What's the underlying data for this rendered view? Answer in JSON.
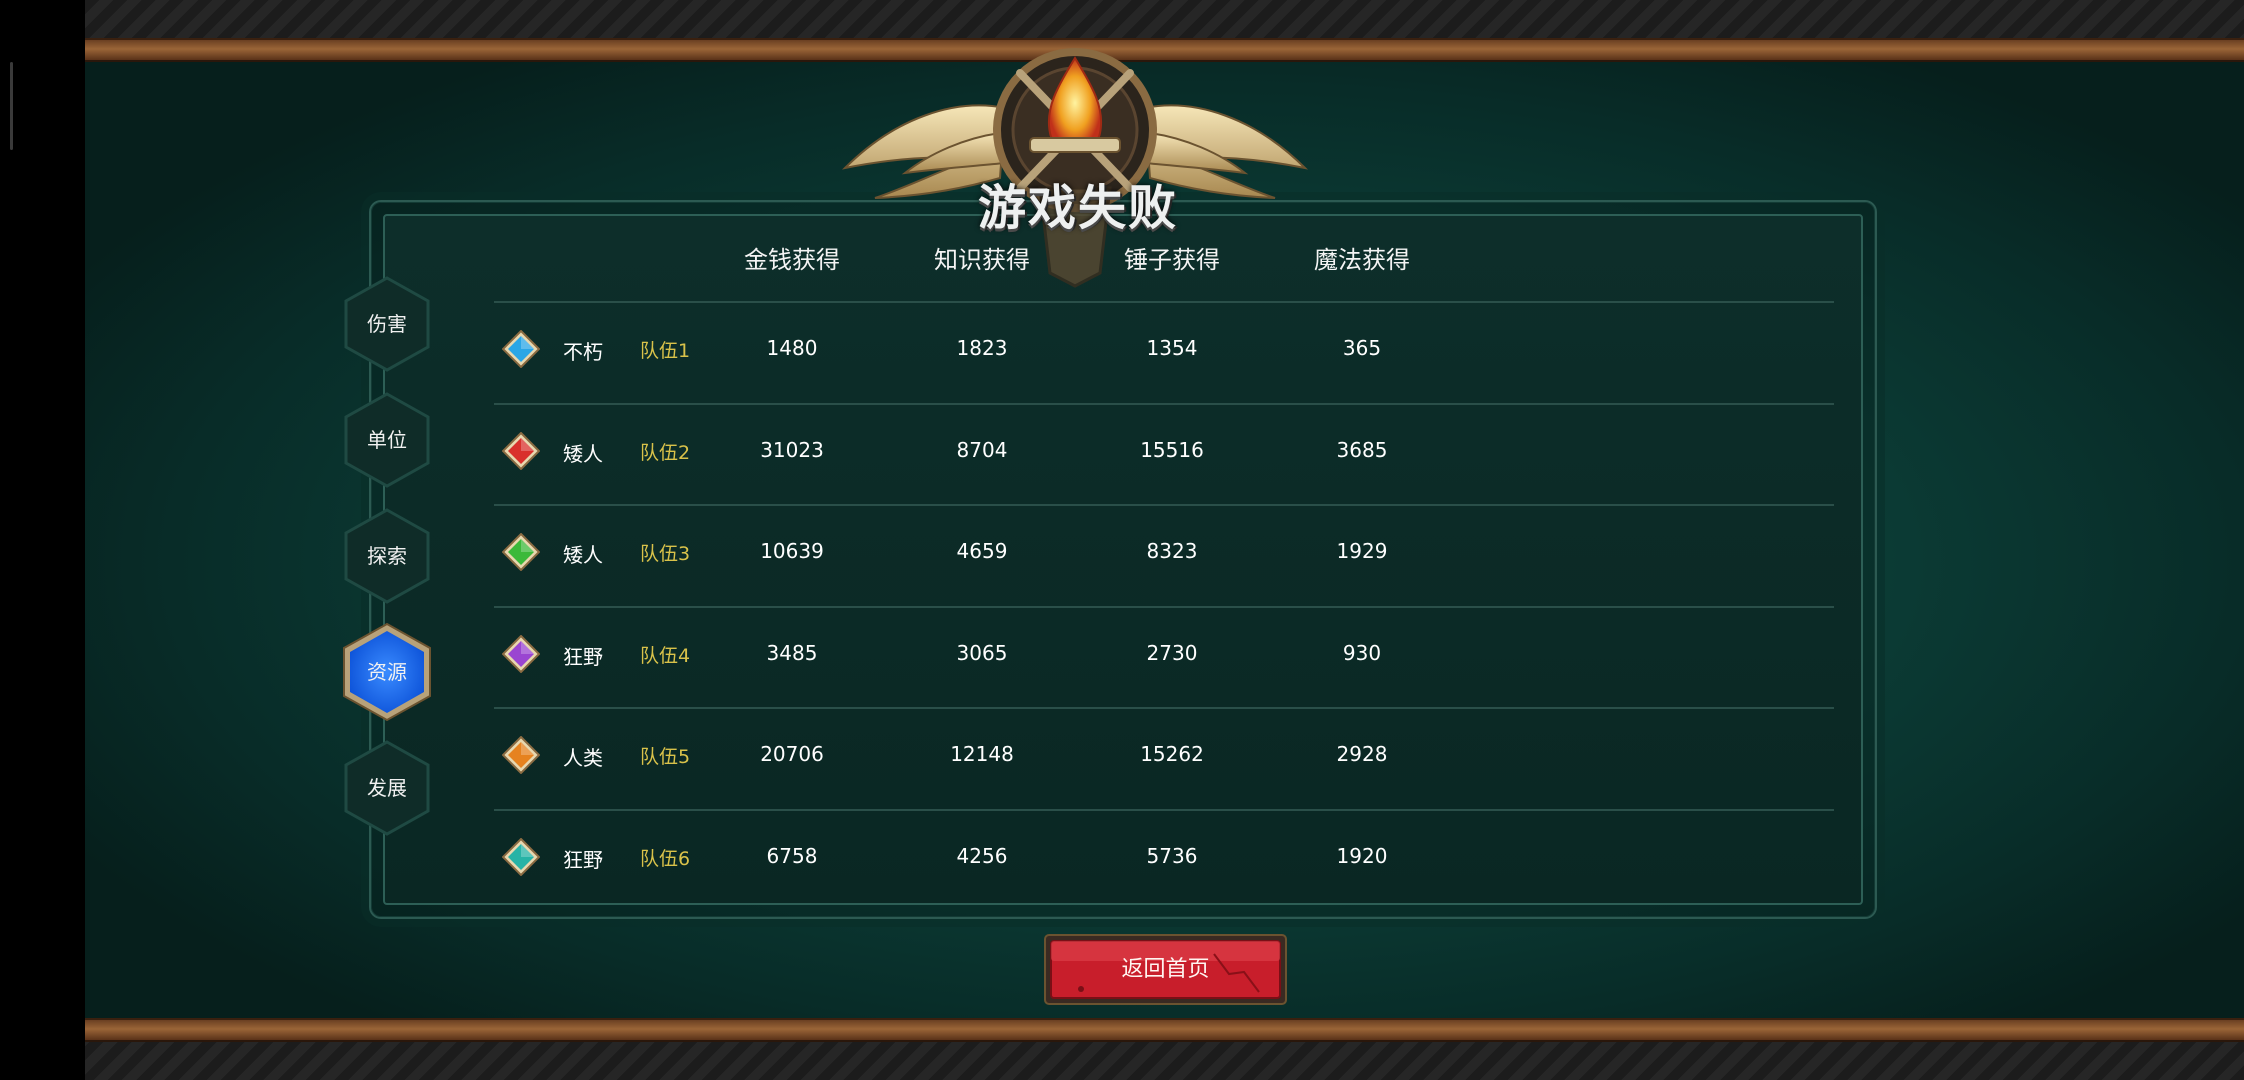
{
  "title": "游戏失败",
  "tabs": [
    {
      "label": "伤害",
      "active": false
    },
    {
      "label": "单位",
      "active": false
    },
    {
      "label": "探索",
      "active": false
    },
    {
      "label": "资源",
      "active": true
    },
    {
      "label": "发展",
      "active": false
    }
  ],
  "columns": [
    "金钱获得",
    "知识获得",
    "锤子获得",
    "魔法获得"
  ],
  "rows": [
    {
      "gem_color": "#2aa6e6",
      "race": "不朽",
      "team": "队伍1",
      "gold": "1480",
      "knowledge": "1823",
      "hammer": "1354",
      "magic": "365"
    },
    {
      "gem_color": "#d9302c",
      "race": "矮人",
      "team": "队伍2",
      "gold": "31023",
      "knowledge": "8704",
      "hammer": "15516",
      "magic": "3685"
    },
    {
      "gem_color": "#3bb93a",
      "race": "矮人",
      "team": "队伍3",
      "gold": "10639",
      "knowledge": "4659",
      "hammer": "8323",
      "magic": "1929"
    },
    {
      "gem_color": "#9a45d1",
      "race": "狂野",
      "team": "队伍4",
      "gold": "3485",
      "knowledge": "3065",
      "hammer": "2730",
      "magic": "930"
    },
    {
      "gem_color": "#e6821f",
      "race": "人类",
      "team": "队伍5",
      "gold": "20706",
      "knowledge": "12148",
      "hammer": "15262",
      "magic": "2928"
    },
    {
      "gem_color": "#27b3a6",
      "race": "狂野",
      "team": "队伍6",
      "gold": "6758",
      "knowledge": "4256",
      "hammer": "5736",
      "magic": "1920"
    }
  ],
  "return_button": "返回首页",
  "colors": {
    "team_label": "#d9c24a",
    "active_tab": "#1a6dff",
    "return_button": "#c81e2b"
  }
}
